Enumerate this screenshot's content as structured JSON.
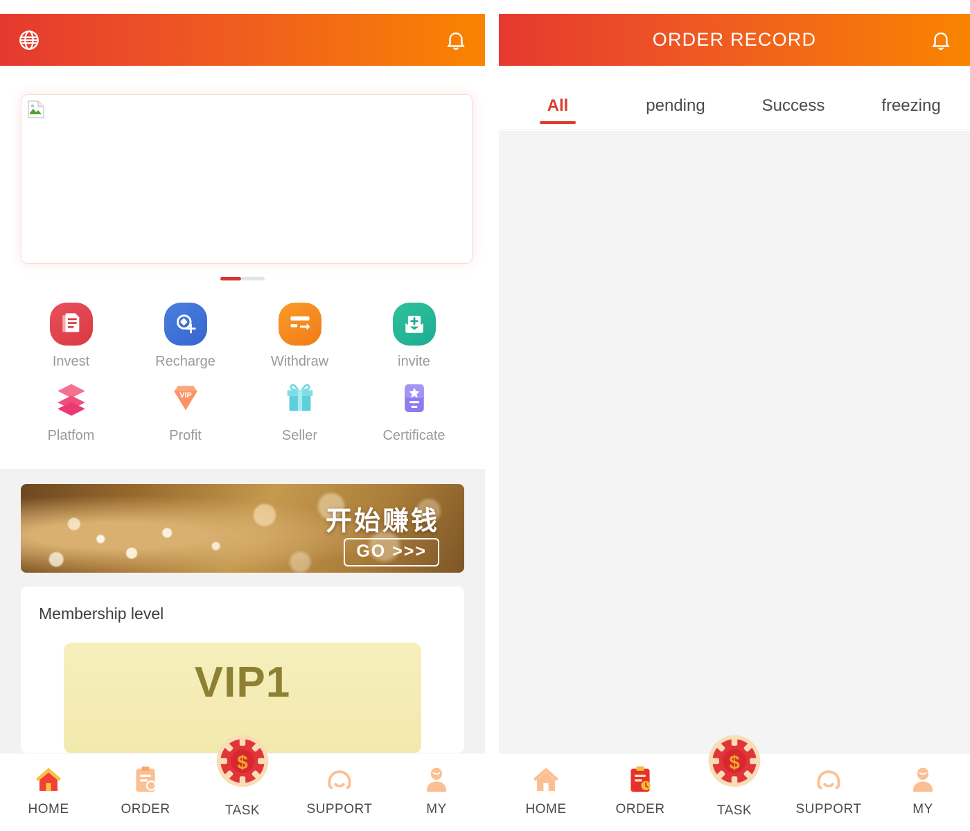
{
  "colors": {
    "gradient_start": "#e5392f",
    "gradient_end": "#f98400",
    "accent_red": "#e03a2f",
    "muted_label": "#9a9a9a",
    "panel_bg": "#f2f2f2",
    "vip_card": "#f3ebb0",
    "vip_text": "#8d8033"
  },
  "left_panel": {
    "header": {
      "language_icon": "globe-icon",
      "notification_icon": "bell-icon"
    },
    "carousel": {
      "image_alt": "broken-image",
      "dots": [
        {
          "active": true
        },
        {
          "active": false
        }
      ]
    },
    "shortcuts": [
      {
        "label": "Invest",
        "icon": "document-invest-icon"
      },
      {
        "label": "Recharge",
        "icon": "recharge-plus-icon"
      },
      {
        "label": "Withdraw",
        "icon": "card-withdraw-icon"
      },
      {
        "label": "invite",
        "icon": "envelope-invite-icon"
      },
      {
        "label": "Platfom",
        "icon": "layers-platform-icon"
      },
      {
        "label": "Profit",
        "icon": "vip-diamond-icon"
      },
      {
        "label": "Seller",
        "icon": "gift-seller-icon"
      },
      {
        "label": "Certificate",
        "icon": "certificate-badge-icon"
      }
    ],
    "banner": {
      "headline": "开始赚钱",
      "cta": "GO >>>"
    },
    "membership": {
      "title": "Membership level",
      "level": "VIP1"
    }
  },
  "right_panel": {
    "header": {
      "title": "ORDER RECORD",
      "notification_icon": "bell-icon"
    },
    "tabs": [
      {
        "label": "All",
        "active": true
      },
      {
        "label": "pending",
        "active": false
      },
      {
        "label": "Success",
        "active": false
      },
      {
        "label": "freezing",
        "active": false
      }
    ],
    "body": {
      "empty": true
    }
  },
  "tabbar": {
    "items": [
      {
        "label": "HOME",
        "icon": "home-icon",
        "active_left": true,
        "active_right": false
      },
      {
        "label": "ORDER",
        "icon": "clipboard-icon",
        "active_left": false,
        "active_right": true
      },
      {
        "label": "TASK",
        "icon": "coin-chip-icon",
        "active_left": false,
        "active_right": false
      },
      {
        "label": "SUPPORT",
        "icon": "headset-icon",
        "active_left": false,
        "active_right": false
      },
      {
        "label": "MY",
        "icon": "user-icon",
        "active_left": false,
        "active_right": false
      }
    ]
  }
}
